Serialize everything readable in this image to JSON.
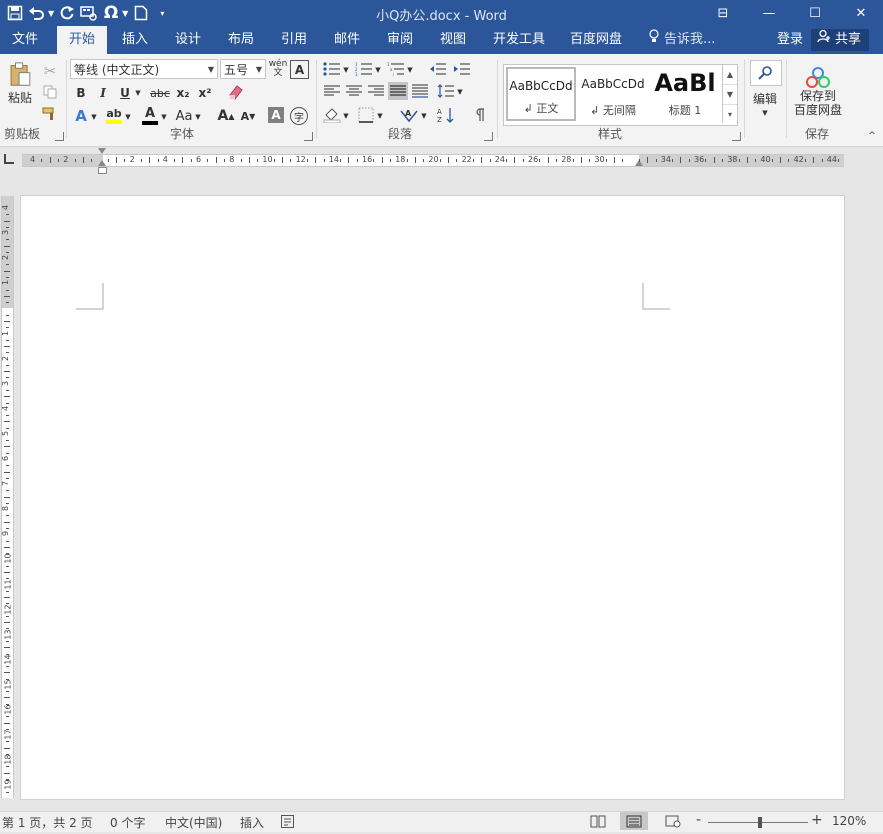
{
  "title_bar": {
    "doc_title": "小Q办公.docx - Word",
    "win_buttons": {
      "ribbon_display": "⊟",
      "minimize": "—",
      "restore": "☐",
      "close": "✕"
    }
  },
  "tabs": [
    "文件",
    "开始",
    "插入",
    "设计",
    "布局",
    "引用",
    "邮件",
    "审阅",
    "视图",
    "开发工具",
    "百度网盘"
  ],
  "active_tab": "开始",
  "tell_me": "告诉我...",
  "account": {
    "login": "登录",
    "share": "共享"
  },
  "ribbon": {
    "clipboard": {
      "label": "剪贴板",
      "paste": "粘贴"
    },
    "font": {
      "label": "字体",
      "font_name": "等线 (中文正文)",
      "font_size": "五号",
      "bold": "B",
      "italic": "I",
      "underline": "U",
      "strike": "abc",
      "subscript": "x₂",
      "superscript": "x²",
      "case": "Aa",
      "grow": "A",
      "shrink": "A",
      "char_border": "A",
      "enclose": "字",
      "phonetic_top": "wén",
      "phonetic_bottom": "文"
    },
    "paragraph": {
      "label": "段落"
    },
    "styles": {
      "label": "样式",
      "items": [
        {
          "sample": "AaBbCcDd",
          "name": "正文"
        },
        {
          "sample": "AaBbCcDd",
          "name": "无间隔"
        },
        {
          "sample": "AaBl",
          "name": "标题 1"
        }
      ]
    },
    "editing": {
      "label": "编辑"
    },
    "save": {
      "label": "保存",
      "button_line1": "保存到",
      "button_line2": "百度网盘"
    }
  },
  "ruler": {
    "horizontal_labels": [
      "4",
      "2",
      "",
      "2",
      "4",
      "6",
      "8",
      "10",
      "12",
      "14",
      "16",
      "18",
      "20",
      "22",
      "24",
      "26",
      "28",
      "30",
      "",
      "34",
      "36",
      "38",
      "40",
      "42",
      "44"
    ],
    "vertical_labels": [
      "4",
      "3",
      "2",
      "1",
      "",
      "1",
      "2",
      "3",
      "4",
      "5",
      "6",
      "7",
      "8",
      "9",
      "10",
      "11",
      "12",
      "13",
      "14",
      "15",
      "16",
      "17",
      "18",
      "19"
    ]
  },
  "status_bar": {
    "page_info": "第 1 页，共 2 页",
    "word_count": "0 个字",
    "language": "中文(中国)",
    "mode": "插入",
    "zoom_minus": "-",
    "zoom_plus": "+",
    "zoom": "120%"
  },
  "colors": {
    "brand": "#2b579a",
    "highlight": "#ffff00",
    "font_color_bar": "#000000",
    "char_shading": "#808080"
  },
  "icons": [
    "save-icon",
    "undo-icon",
    "redo-icon",
    "format-painter-icon",
    "omega-icon",
    "new-document-icon",
    "lightbulb-icon",
    "user-icon",
    "search-icon",
    "baidu-cloud-icon"
  ]
}
